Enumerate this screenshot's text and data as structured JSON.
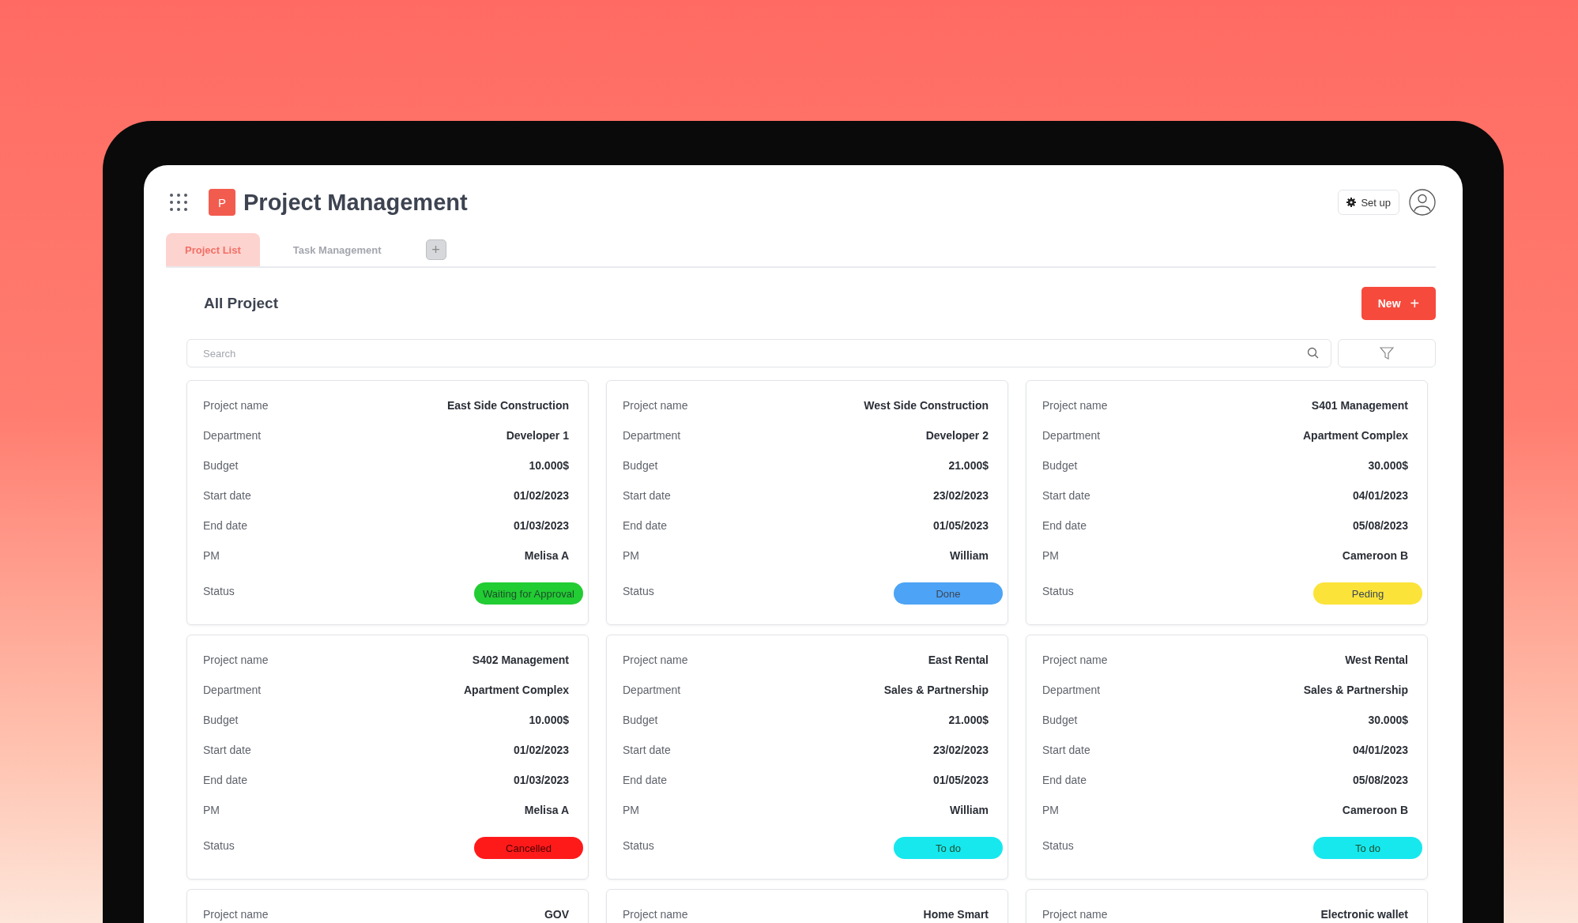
{
  "app": {
    "logo_letter": "P",
    "title": "Project Management",
    "setup_button": "Set up"
  },
  "tabs": [
    {
      "label": "Project List",
      "selected": true
    },
    {
      "label": "Task Management",
      "selected": false
    }
  ],
  "section": {
    "title": "All Project",
    "new_button": "New",
    "add_symbol": "+"
  },
  "search": {
    "placeholder": "Search"
  },
  "cards": [
    {
      "fields": [
        {
          "label": "Project name",
          "value": "East Side Construction"
        },
        {
          "label": "Department",
          "value": "Developer 1"
        },
        {
          "label": "Budget",
          "value": "10.000$"
        },
        {
          "label": "Start date",
          "value": "01/02/2023"
        },
        {
          "label": "End date",
          "value": "01/03/2023"
        },
        {
          "label": "PM",
          "value": "Melisa A"
        }
      ],
      "status": {
        "label": "Status",
        "value": "Waiting for Approval",
        "color": "#22cc33"
      }
    },
    {
      "fields": [
        {
          "label": "Project name",
          "value": "West Side Construction"
        },
        {
          "label": "Department",
          "value": "Developer 2"
        },
        {
          "label": "Budget",
          "value": "21.000$"
        },
        {
          "label": "Start date",
          "value": "23/02/2023"
        },
        {
          "label": "End date",
          "value": "01/05/2023"
        },
        {
          "label": "PM",
          "value": "William"
        }
      ],
      "status": {
        "label": "Status",
        "value": "Done",
        "color": "#4da3f5"
      }
    },
    {
      "fields": [
        {
          "label": "Project name",
          "value": "S401 Management"
        },
        {
          "label": "Department",
          "value": "Apartment Complex"
        },
        {
          "label": "Budget",
          "value": "30.000$"
        },
        {
          "label": "Start date",
          "value": "04/01/2023"
        },
        {
          "label": "End date",
          "value": "05/08/2023"
        },
        {
          "label": "PM",
          "value": "Cameroon B"
        }
      ],
      "status": {
        "label": "Status",
        "value": "Peding",
        "color": "#fbe33a"
      }
    },
    {
      "fields": [
        {
          "label": "Project name",
          "value": "S402 Management"
        },
        {
          "label": "Department",
          "value": "Apartment Complex"
        },
        {
          "label": "Budget",
          "value": "10.000$"
        },
        {
          "label": "Start date",
          "value": "01/02/2023"
        },
        {
          "label": "End date",
          "value": "01/03/2023"
        },
        {
          "label": "PM",
          "value": "Melisa A"
        }
      ],
      "status": {
        "label": "Status",
        "value": "Cancelled",
        "color": "#ff1a1a"
      }
    },
    {
      "fields": [
        {
          "label": "Project name",
          "value": "East Rental"
        },
        {
          "label": "Department",
          "value": "Sales & Partnership"
        },
        {
          "label": "Budget",
          "value": "21.000$"
        },
        {
          "label": "Start date",
          "value": "23/02/2023"
        },
        {
          "label": "End date",
          "value": "01/05/2023"
        },
        {
          "label": "PM",
          "value": "William"
        }
      ],
      "status": {
        "label": "Status",
        "value": "To do",
        "color": "#16e8ee"
      }
    },
    {
      "fields": [
        {
          "label": "Project name",
          "value": "West Rental"
        },
        {
          "label": "Department",
          "value": "Sales & Partnership"
        },
        {
          "label": "Budget",
          "value": "30.000$"
        },
        {
          "label": "Start date",
          "value": "04/01/2023"
        },
        {
          "label": "End date",
          "value": "05/08/2023"
        },
        {
          "label": "PM",
          "value": "Cameroon B"
        }
      ],
      "status": {
        "label": "Status",
        "value": "To do",
        "color": "#16e8ee"
      }
    },
    {
      "fields": [
        {
          "label": "Project name",
          "value": "GOV"
        }
      ]
    },
    {
      "fields": [
        {
          "label": "Project name",
          "value": "Home Smart"
        }
      ]
    },
    {
      "fields": [
        {
          "label": "Project name",
          "value": "Electronic wallet"
        }
      ]
    }
  ]
}
